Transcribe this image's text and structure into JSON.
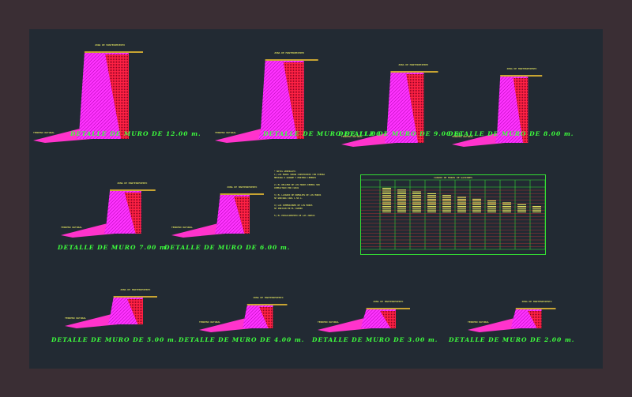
{
  "palette": {
    "background": "#222a33",
    "frame": "#3a2e34",
    "wall_fill": "#ff33ff",
    "wall_hatch": "#aa00aa",
    "ground": "#ff33cc",
    "soil": "#ff2244",
    "label_text": "#ffff66",
    "title_text": "#3dff3d",
    "table_lines": "#33dd33",
    "table_cells": "#cc3333"
  },
  "walls": [
    {
      "title": "DETALLE DE MURO DE 12.00 m.",
      "label_top": "ZONA DE MANTENIMIENTO",
      "label_left": "TERRENO NATURAL"
    },
    {
      "title": "DETALLE DE MURO DE 11.00 m.",
      "label_top": "ZONA DE MANTENIMIENTO",
      "label_left": "TERRENO NATURAL"
    },
    {
      "title": "DETALLE DE MURO DE 9.00 m.",
      "label_top": "ZONA DE MANTENIMIENTO",
      "label_left": "TERRENO NATURAL"
    },
    {
      "title": "DETALLE DE MURO DE 8.00 m.",
      "label_top": "ZONA DE MANTENIMIENTO",
      "label_left": "TERRENO NATURAL"
    },
    {
      "title": "DETALLE DE MURO 7.00 m.",
      "label_top": "ZONA DE MANTENIMIENTO",
      "label_left": "TERRENO NATURAL"
    },
    {
      "title": "DETALLE DE MURO DE 6.00 m.",
      "label_top": "ZONA DE MANTENIMIENTO",
      "label_left": "TERRENO NATURAL"
    },
    {
      "title": "DETALLE DE MURO DE 5.00 m.",
      "label_top": "ZONA DE MANTENIMIENTO",
      "label_left": "TERRENO NATURAL"
    },
    {
      "title": "DETALLE DE MURO DE 4.00 m.",
      "label_top": "ZONA DE MANTENIMIENTO",
      "label_left": "TERRENO NATURAL"
    },
    {
      "title": "DETALLE DE MURO DE 3.00 m.",
      "label_top": "ZONA DE MANTENIMIENTO",
      "label_left": "TERRENO NATURAL"
    },
    {
      "title": "DETALLE DE MURO DE 2.00 m.",
      "label_top": "ZONA DE MANTENIMIENTO",
      "label_left": "TERRENO NATURAL"
    }
  ],
  "notes": {
    "heading": "* NOTAS GENERALES:",
    "lines": [
      "1) LOS MUROS SERAN CONSTRUIDOS CON PIEDRA",
      "MEDIANA O GRANDE Y MORTERO CEMENTO",
      "2) EL RELLENO DE LOS MUROS DEBERA SER",
      "COMPACTADO POR CAPAS",
      "3) EL LLORADO DE DRENAJES DE LOS MUROS",
      "SE UBICARA CADA 1.50 m.",
      "4) LAS DIMENSIONES DE LOS MUROS",
      "SE INDICAN EN EL CUADRO",
      "5) EL ESPACIAMIENTO DE LAS JUNTAS"
    ]
  },
  "table": {
    "title": "CUADRO DE MUROS DE GAVIONES"
  }
}
